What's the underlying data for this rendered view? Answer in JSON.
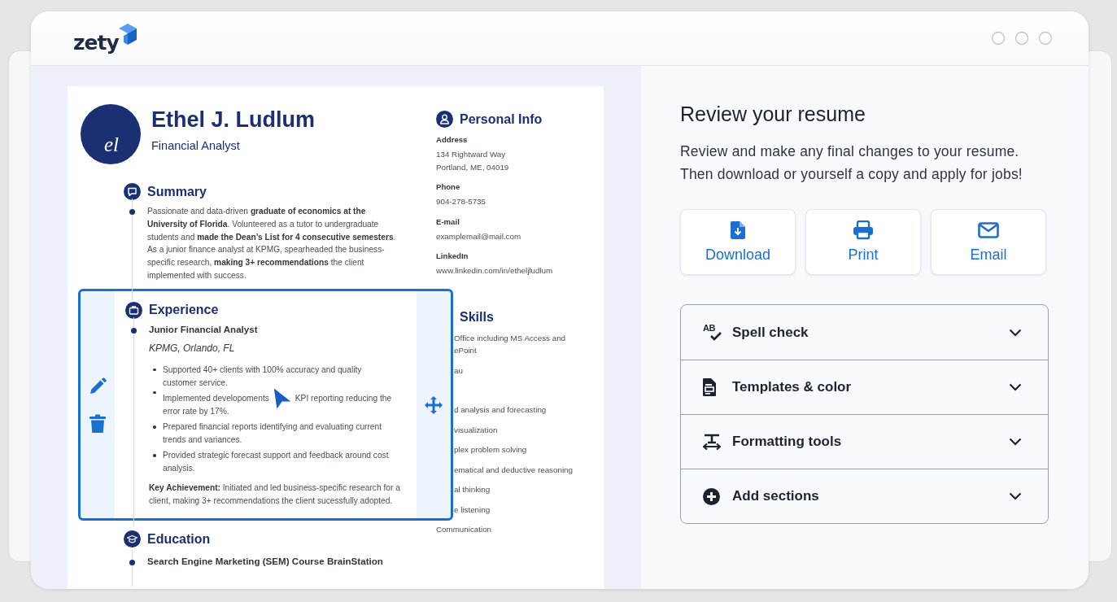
{
  "app": {
    "logo": "zety"
  },
  "resume": {
    "initials": "el",
    "name": "Ethel J. Ludlum",
    "job_title": "Financial Analyst",
    "summary": {
      "heading": "Summary",
      "text": "Passionate and data-driven **graduate of economics at the University of Florida**. Volunteered as a tutor to undergraduate students and **made the Dean’s List for 4 consecutive semesters**. As a junior finance analyst at KPMG, spearheaded the business-specific research, **making 3+ recommendations** the client implemented with success."
    },
    "experience": {
      "heading": "Experience",
      "selected": true,
      "role": "Junior Financial Analyst",
      "company": "KPMG, Orlando, FL",
      "bullets": [
        {
          "parts": [
            "Supported 40+ clients with 100% accuracy and quality customer service."
          ]
        },
        {
          "parts": [
            "Implemented developoments",
            "KPI reporting reducing the",
            "error rate by 17%."
          ]
        },
        {
          "parts": [
            "Prepared financial reports identifying and evaluating current trends and variances."
          ]
        },
        {
          "parts": [
            "Provided strategic forecast support and feedback around cost analysis."
          ]
        }
      ],
      "key_achievement": "**Key Achievement:** Initiated and led business-specific research for a client, making 3+  recommendations the client sucessfully adopted."
    },
    "education": {
      "heading": "Education",
      "course": "Search Engine Marketing (SEM) Course BrainStation"
    },
    "personal_info": {
      "heading": "Personal Info",
      "fields": [
        {
          "label": "Address",
          "lines": [
            "134 Rightward Way",
            "Portland, ME, 04019"
          ]
        },
        {
          "label": "Phone",
          "lines": [
            "904-278-5735"
          ]
        },
        {
          "label": "E-mail",
          "lines": [
            "examplemail@mail.com"
          ]
        },
        {
          "label": "LinkedIn",
          "lines": [
            "www.linkedin.com/in/etheljludlum"
          ]
        }
      ]
    },
    "skills": {
      "heading": "Skills",
      "items": [
        "Office including MS Access and",
        "ePoint",
        "au",
        "d analysis and forecasting",
        "visualization",
        "plex problem solving",
        "ematical and deductive reasoning",
        "al thinking",
        "e listening",
        "Communication"
      ]
    }
  },
  "review": {
    "title": "Review your resume",
    "description": "Review and make any final changes to your resume. Then download or yourself a copy and apply for jobs!",
    "actions": [
      {
        "kind": "download",
        "label": "Download"
      },
      {
        "kind": "print",
        "label": "Print"
      },
      {
        "kind": "email",
        "label": "Email"
      }
    ],
    "sections": [
      {
        "kind": "spell",
        "icon_text": "AB",
        "label": "Spell check",
        "expanded": false
      },
      {
        "kind": "templates",
        "label": "Templates & color",
        "expanded": false
      },
      {
        "kind": "formatting",
        "label": "Formatting tools",
        "expanded": false
      },
      {
        "kind": "add",
        "label": "Add sections",
        "expanded": false
      }
    ]
  }
}
